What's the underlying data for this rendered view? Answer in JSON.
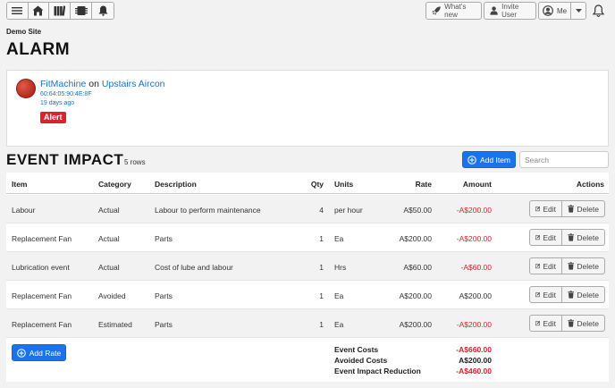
{
  "topbar": {
    "whats_new": "What's new",
    "invite_user": "Invite User",
    "me": "Me"
  },
  "site_name": "Demo Site",
  "page_title": "ALARM",
  "alarm": {
    "machine_name": "FitMachine",
    "on_text": "on",
    "location": "Upstairs Aircon",
    "mac": "60:64:05:90:4E:8F",
    "time_ago": "19 days ago",
    "badge": "Alert"
  },
  "impact": {
    "title": "EVENT IMPACT",
    "row_count": "5 rows",
    "add_item_label": "Add Item",
    "search_placeholder": "Search"
  },
  "table": {
    "headers": {
      "item": "Item",
      "category": "Category",
      "description": "Description",
      "qty": "Qty",
      "units": "Units",
      "rate": "Rate",
      "amount": "Amount",
      "actions": "Actions"
    },
    "edit_label": "Edit",
    "delete_label": "Delete",
    "rows": [
      {
        "item": "Labour",
        "category": "Actual",
        "description": "Labour to perform maintenance",
        "qty": "4",
        "units": "per hour",
        "rate": "A$50.00",
        "amount": "-A$200.00"
      },
      {
        "item": "Replacement Fan",
        "category": "Actual",
        "description": "Parts",
        "qty": "1",
        "units": "Ea",
        "rate": "A$200.00",
        "amount": "-A$200.00"
      },
      {
        "item": "Lubrication event",
        "category": "Actual",
        "description": "Cost of lube and labour",
        "qty": "1",
        "units": "Hrs",
        "rate": "A$60.00",
        "amount": "-A$60.00"
      },
      {
        "item": "Replacement Fan",
        "category": "Avoided",
        "description": "Parts",
        "qty": "1",
        "units": "Ea",
        "rate": "A$200.00",
        "amount": "A$200.00"
      },
      {
        "item": "Replacement Fan",
        "category": "Estimated",
        "description": "Parts",
        "qty": "1",
        "units": "Ea",
        "rate": "A$200.00",
        "amount": "-A$200.00"
      }
    ]
  },
  "summary": {
    "add_rate_label": "Add Rate",
    "event_costs_label": "Event Costs",
    "event_costs_value": "-A$660.00",
    "avoided_costs_label": "Avoided Costs",
    "avoided_costs_value": "A$200.00",
    "reduction_label": "Event Impact Reduction",
    "reduction_value": "-A$460.00"
  },
  "colors": {
    "primary": "#1a73e8",
    "negative": "#d9232e",
    "link": "#1a73c4"
  }
}
